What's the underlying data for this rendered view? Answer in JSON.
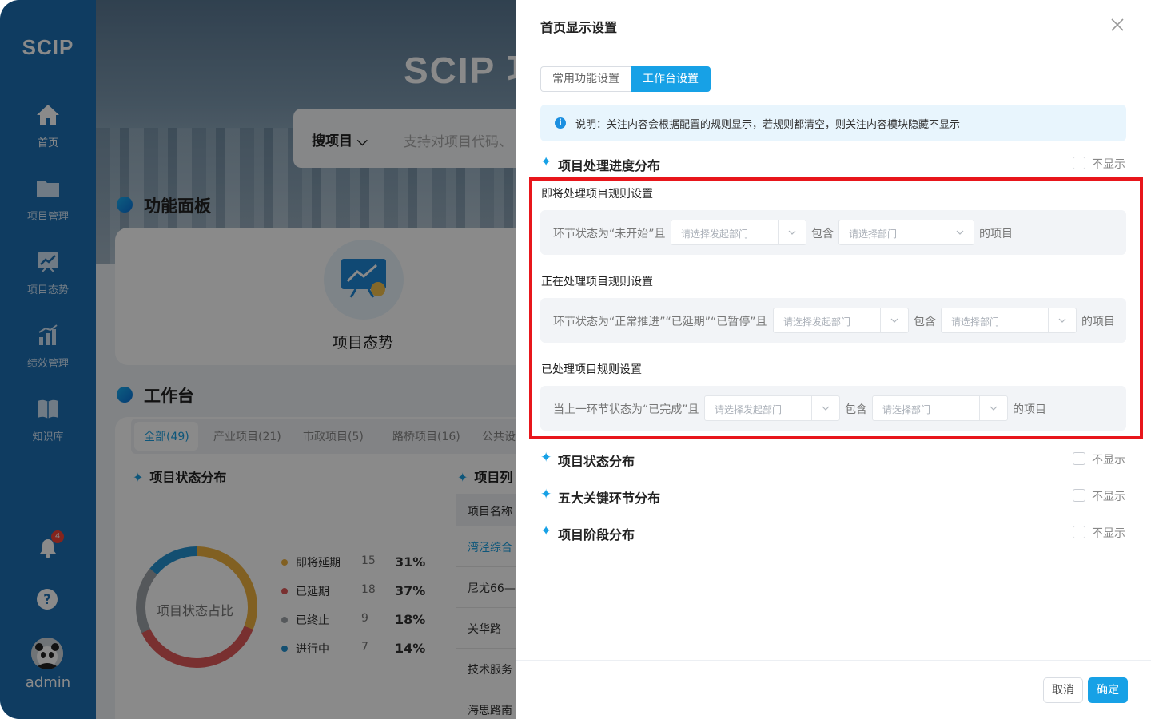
{
  "sidebar": {
    "logo": "SCIP",
    "items": [
      {
        "label": "首页",
        "icon": "home-icon"
      },
      {
        "label": "项目管理",
        "icon": "folder-icon"
      },
      {
        "label": "项目态势",
        "icon": "trend-board-icon"
      },
      {
        "label": "绩效管理",
        "icon": "bar-chart-icon"
      },
      {
        "label": "知识库",
        "icon": "book-icon"
      }
    ],
    "notification_count": "4",
    "user": "admin"
  },
  "background": {
    "hero_logo": "SCIP 功",
    "search_select": "搜项目",
    "search_placeholder": "支持对项目代码、",
    "feature_section_title": "功能面板",
    "feature_label": "项目态势",
    "workbench_title": "工作台",
    "tabs": [
      "全部(49)",
      "产业项目(21)",
      "市政项目(5)",
      "路桥项目(16)",
      "公共设"
    ],
    "status_panel_title": "项目状态分布",
    "donut_center_label": "项目状态占比",
    "legend": [
      {
        "name": "即将延期",
        "count": "15",
        "percent": "31%",
        "color": "#eeb13f"
      },
      {
        "name": "已延期",
        "count": "18",
        "percent": "37%",
        "color": "#e05a5a"
      },
      {
        "name": "已终止",
        "count": "9",
        "percent": "18%",
        "color": "#9ea3a8"
      },
      {
        "name": "进行中",
        "count": "7",
        "percent": "14%",
        "color": "#2492d1"
      }
    ],
    "list_panel_title": "项目列",
    "list_header": "项目名称",
    "list_rows": [
      "湾泾综合",
      "尼尤66—",
      "关华路",
      "技术服务",
      "海思路南"
    ]
  },
  "drawer": {
    "title": "首页显示设置",
    "tabs": [
      "常用功能设置",
      "工作台设置"
    ],
    "notice": "说明：关注内容会根据配置的规则显示，若规则都清空，则关注内容模块隐藏不显示",
    "hide_label": "不显示",
    "sections": [
      "项目处理进度分布",
      "项目状态分布",
      "五大关键环节分布",
      "项目阶段分布"
    ],
    "rules": [
      {
        "title": "即将处理项目规则设置",
        "condition": "环节状态为“未开始”且",
        "dept_placeholder": "请选择发起部门",
        "contains": "包含",
        "dept2_placeholder": "请选择部门",
        "suffix": "的项目"
      },
      {
        "title": "正在处理项目规则设置",
        "condition": "环节状态为“正常推进”“已延期”“已暂停”且",
        "dept_placeholder": "请选择发起部门",
        "contains": "包含",
        "dept2_placeholder": "请选择部门",
        "suffix": "的项目"
      },
      {
        "title": "已处理项目规则设置",
        "condition": "当上一环节状态为“已完成”且",
        "dept_placeholder": "请选择发起部门",
        "contains": "包含",
        "dept2_placeholder": "请选择部门",
        "suffix": "的项目"
      }
    ],
    "cancel": "取消",
    "confirm": "确定",
    "accent_color": "#17a1e6",
    "highlight_color": "#e8161b"
  }
}
